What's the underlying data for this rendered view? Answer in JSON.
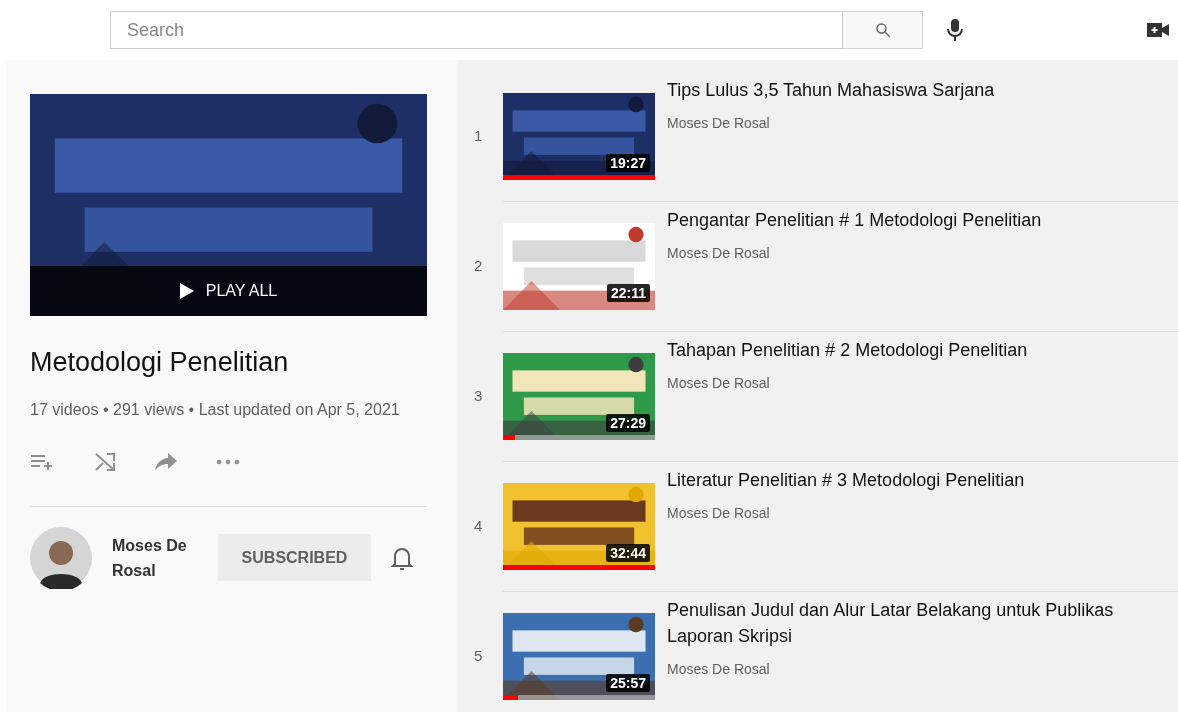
{
  "search": {
    "placeholder": "Search"
  },
  "playlist": {
    "play_all": "PLAY ALL",
    "title": "Metodologi Penelitian",
    "meta": "17 videos • 291 views • Last updated on Apr 5, 2021",
    "owner": {
      "name": "Moses De Rosal",
      "subscribe_label": "SUBSCRIBED",
      "subscribed": true
    }
  },
  "videos": [
    {
      "index": "1",
      "title_lines": [
        "Tips Lulus 3,5 Tahun Mahasiswa Sarjana"
      ],
      "channel": "Moses De Rosal",
      "duration": "19:27",
      "level": 1
    },
    {
      "index": "2",
      "title_lines": [
        "Pengantar Penelitian # 1 Metodologi Penelitian"
      ],
      "channel": "Moses De Rosal",
      "duration": "22:11"
    },
    {
      "index": "3",
      "title_lines": [
        "Tahapan Penelitian # 2 Metodologi Penelitian"
      ],
      "channel": "Moses De Rosal",
      "duration": "27:29",
      "level": 0.08
    },
    {
      "index": "4",
      "title_lines": [
        "Literatur Penelitian # 3 Metodologi Penelitian"
      ],
      "channel": "Moses De Rosal",
      "duration": "32:44",
      "level": 1
    },
    {
      "index": "5",
      "title_lines": [
        "Penulisan Judul dan Alur Latar Belakang untuk Publikas",
        "Laporan Skripsi"
      ],
      "channel": "Moses De Rosal",
      "duration": "25:57",
      "level": 0.1
    }
  ]
}
